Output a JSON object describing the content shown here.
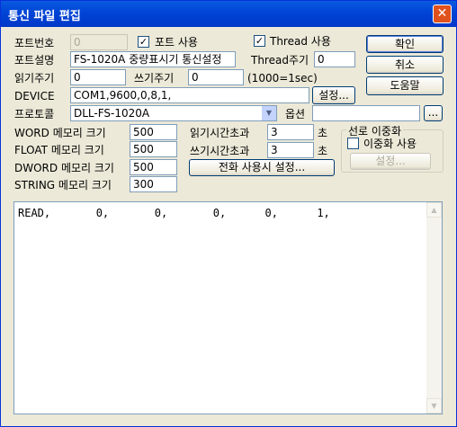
{
  "window": {
    "title": "통신 파일 편집",
    "close_glyph": "✕"
  },
  "port_no": {
    "label": "포트번호",
    "value": "0"
  },
  "port_use": {
    "label": "포트 사용",
    "checked": "✓"
  },
  "thread_use": {
    "label": "Thread 사용",
    "checked": "✓"
  },
  "port_desc": {
    "label": "포트설명",
    "value": "FS-1020A 중량표시기 통신설정"
  },
  "thread_period": {
    "label": "Thread주기",
    "value": "0"
  },
  "read_period": {
    "label": "읽기주기",
    "value": "0"
  },
  "write_period": {
    "label": "쓰기주기",
    "value": "0"
  },
  "period_hint": "(1000=1sec)",
  "device": {
    "label": "DEVICE",
    "value": "COM1,9600,0,8,1,",
    "setting_button": "설정..."
  },
  "protocol": {
    "label": "프로토콜",
    "value": "DLL-FS-1020A",
    "arrow_glyph": "▼"
  },
  "option": {
    "label": "옵션",
    "value": "",
    "browse_button": "..."
  },
  "memory": {
    "word": {
      "label": "WORD 메모리 크기",
      "value": "500"
    },
    "float": {
      "label": "FLOAT 메모리 크기",
      "value": "500"
    },
    "dword": {
      "label": "DWORD 메모리 크기",
      "value": "500"
    },
    "string": {
      "label": "STRING 메모리 크기",
      "value": "300"
    }
  },
  "read_timeout": {
    "label": "읽기시간초과",
    "value": "3",
    "unit": "초"
  },
  "write_timeout": {
    "label": "쓰기시간초과",
    "value": "3",
    "unit": "초"
  },
  "phone_setting_button": "전화 사용시 설정...",
  "redundancy": {
    "group_title": "선로 이중화",
    "use_label": "이중화 사용",
    "setting_button": "설정..."
  },
  "buttons": {
    "ok": "확인",
    "cancel": "취소",
    "help": "도움말"
  },
  "text_content": "READ,       0,       0,       0,      0,      1,",
  "scrollbar": {
    "up_glyph": "▲",
    "down_glyph": "▼"
  }
}
